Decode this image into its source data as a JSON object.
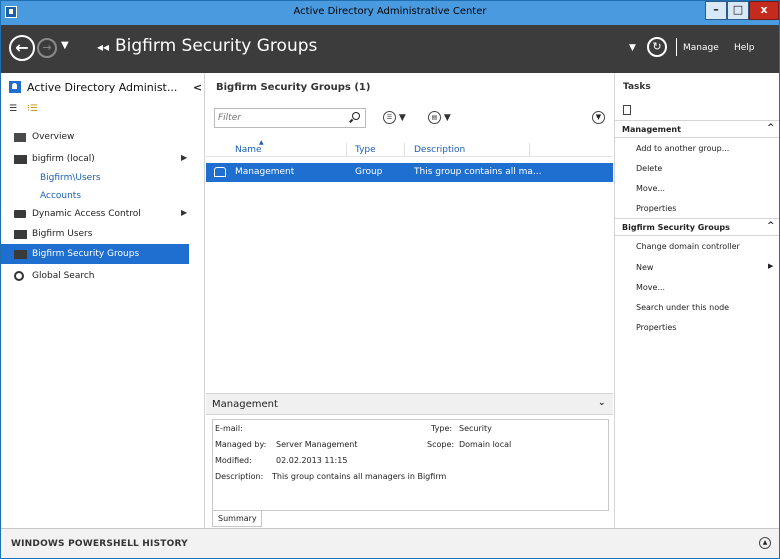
{
  "window": {
    "title": "Active Directory Administrative Center",
    "min_glyph": "–",
    "max_glyph": "□",
    "close_glyph": "x"
  },
  "nav": {
    "back_glyph": "←",
    "forward_glyph": "→",
    "dropdown_glyph": "▼",
    "crumb_arrows": "◂◂",
    "breadcrumb": "Bigfirm Security Groups",
    "manage": "Manage",
    "help": "Help"
  },
  "left": {
    "title": "Active Directory Administ...",
    "collapse_glyph": "<",
    "list_view_glyph": "☰",
    "tree_view_glyph": "⁝☰",
    "items": [
      {
        "label": "Overview"
      },
      {
        "label": "bigfirm (local)"
      },
      {
        "label": "Bigfirm\\Users"
      },
      {
        "label": "Accounts"
      },
      {
        "label": "Dynamic Access Control"
      },
      {
        "label": "Bigfirm Users"
      },
      {
        "label": "Bigfirm Security Groups"
      },
      {
        "label": "Global Search"
      }
    ],
    "expand_glyph": "▶"
  },
  "center": {
    "title": "Bigfirm Security Groups  (1)",
    "filter_placeholder": "Filter",
    "columns": [
      "Name",
      "Type",
      "Description"
    ],
    "sort_indicator": "▲",
    "rows": [
      {
        "name": "Management",
        "type": "Group",
        "description": "This group contains all ma..."
      }
    ],
    "details": {
      "header": "Management",
      "email_label": "E-mail:",
      "managed_by_label": "Managed by:",
      "managed_by": "Server Management",
      "modified_label": "Modified:",
      "modified": "02.02.2013 11:15",
      "description_label": "Description:",
      "description": "This group contains all managers in Bigfirm",
      "type_label": "Type:",
      "type": "Security",
      "scope_label": "Scope:",
      "scope": "Domain local",
      "tab": "Summary"
    }
  },
  "tasks": {
    "title": "Tasks",
    "sections": [
      {
        "label": "Management",
        "items": [
          "Add to another group...",
          "Delete",
          "Move...",
          "Properties"
        ]
      },
      {
        "label": "Bigfirm Security Groups",
        "items": [
          "Change domain controller",
          "New",
          "Move...",
          "Search under this node",
          "Properties"
        ]
      }
    ],
    "caret_up": "^",
    "submenu_arrow": "▶"
  },
  "bottom": {
    "title": "WINDOWS POWERSHELL HISTORY"
  },
  "colors": {
    "title_bar": "#4a9ae0",
    "nav_bar": "#3c3c3c",
    "selection": "#1e6fd0",
    "link": "#1a5fb4",
    "close": "#c42b1c"
  }
}
